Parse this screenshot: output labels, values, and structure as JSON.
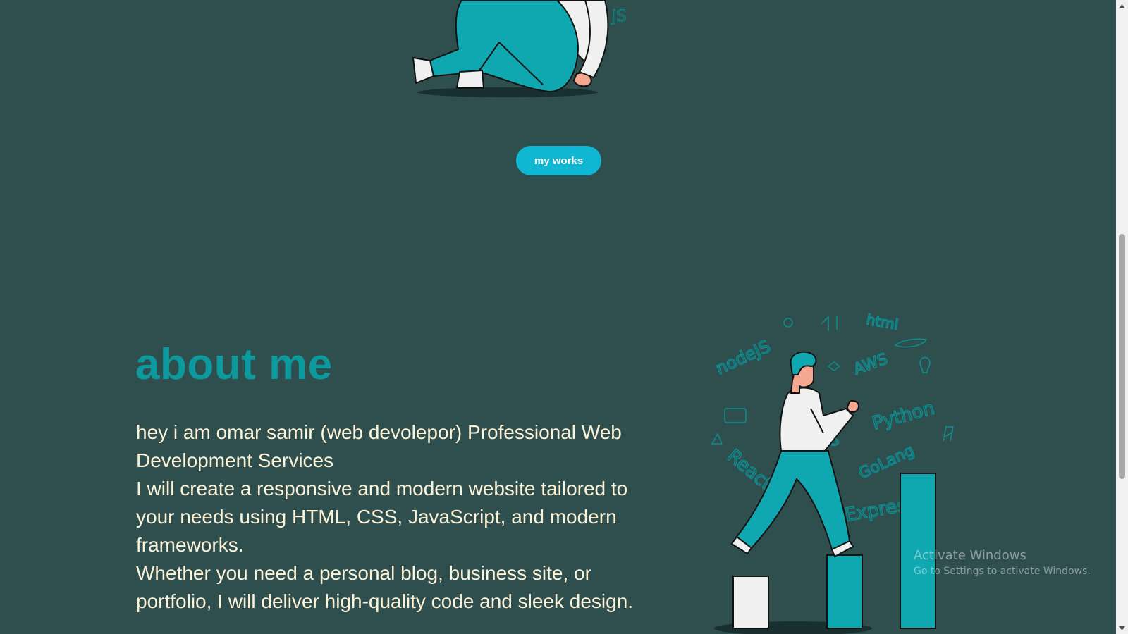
{
  "hero": {
    "button_label": "my works"
  },
  "about": {
    "title": "about me",
    "paragraph_lines": [
      "hey i am omar samir (web devolepor) Professional Web Development Services",
      "I will create a responsive and modern website tailored to your needs using HTML, CSS, JavaScript, and modern frameworks.",
      "Whether you need a personal blog, business site, or portfolio, I will deliver high-quality code and sleek design."
    ]
  },
  "illustration_doodles": [
    "nodeJS",
    "html",
    "AWS",
    "Python",
    "GoLang",
    "React",
    "Express",
    "JS"
  ],
  "watermark": {
    "title": "Activate Windows",
    "subtitle": "Go to Settings to activate Windows."
  },
  "colors": {
    "background": "#2f4f4f",
    "accent_teal": "#0d9a9e",
    "button": "#10b7d3",
    "text": "#fdf3d8"
  }
}
